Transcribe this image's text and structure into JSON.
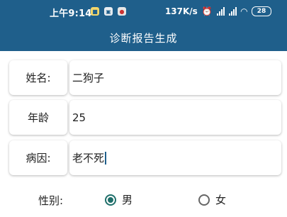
{
  "status_bar": {
    "time": "上午9:14",
    "notification_icons": [
      "notification-icon-yellow",
      "notification-icon-white",
      "notification-icon-red"
    ],
    "net_speed": "137K/s",
    "battery": "28"
  },
  "toolbar": {
    "title": "诊断报告生成"
  },
  "form": {
    "name": {
      "label": "姓名:",
      "value": "二狗子"
    },
    "age": {
      "label": "年龄",
      "value": "25"
    },
    "cause": {
      "label": "病因:",
      "value": "老不死"
    }
  },
  "gender": {
    "label": "性别:",
    "options": [
      {
        "label": "男",
        "selected": true
      },
      {
        "label": "女",
        "selected": false
      }
    ]
  },
  "colors": {
    "bar": "#1f5f8b",
    "radio_accent": "#1f6f6a"
  }
}
